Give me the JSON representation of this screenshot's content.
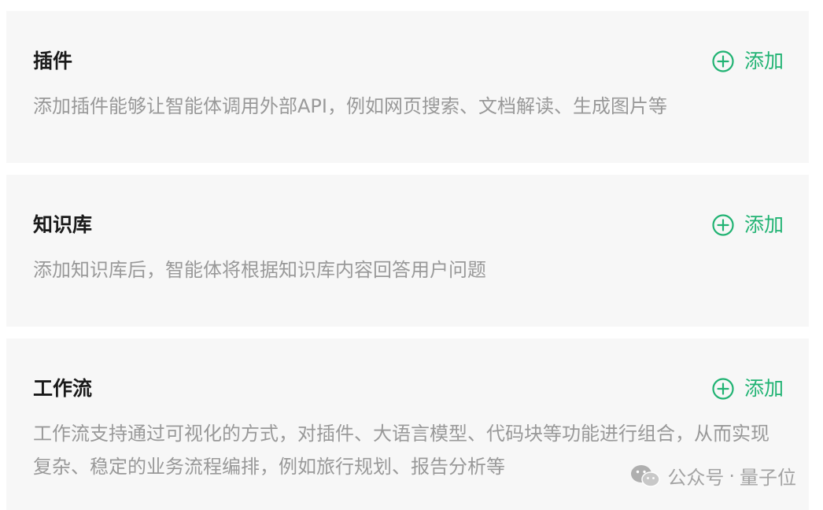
{
  "sections": [
    {
      "title": "插件",
      "description": "添加插件能够让智能体调用外部API，例如网页搜索、文档解读、生成图片等",
      "add_label": "添加"
    },
    {
      "title": "知识库",
      "description": "添加知识库后，智能体将根据知识库内容回答用户问题",
      "add_label": "添加"
    },
    {
      "title": "工作流",
      "description": "工作流支持通过可视化的方式，对插件、大语言模型、代码块等功能进行组合，从而实现复杂、稳定的业务流程编排，例如旅行规划、报告分析等",
      "add_label": "添加"
    }
  ],
  "watermark": {
    "source": "公众号",
    "separator": "·",
    "account": "量子位",
    "icon": "wechat-icon"
  },
  "colors": {
    "accent": "#21b373",
    "card_bg": "#f7f7f7",
    "title": "#1a1a1a",
    "description": "#999999"
  }
}
